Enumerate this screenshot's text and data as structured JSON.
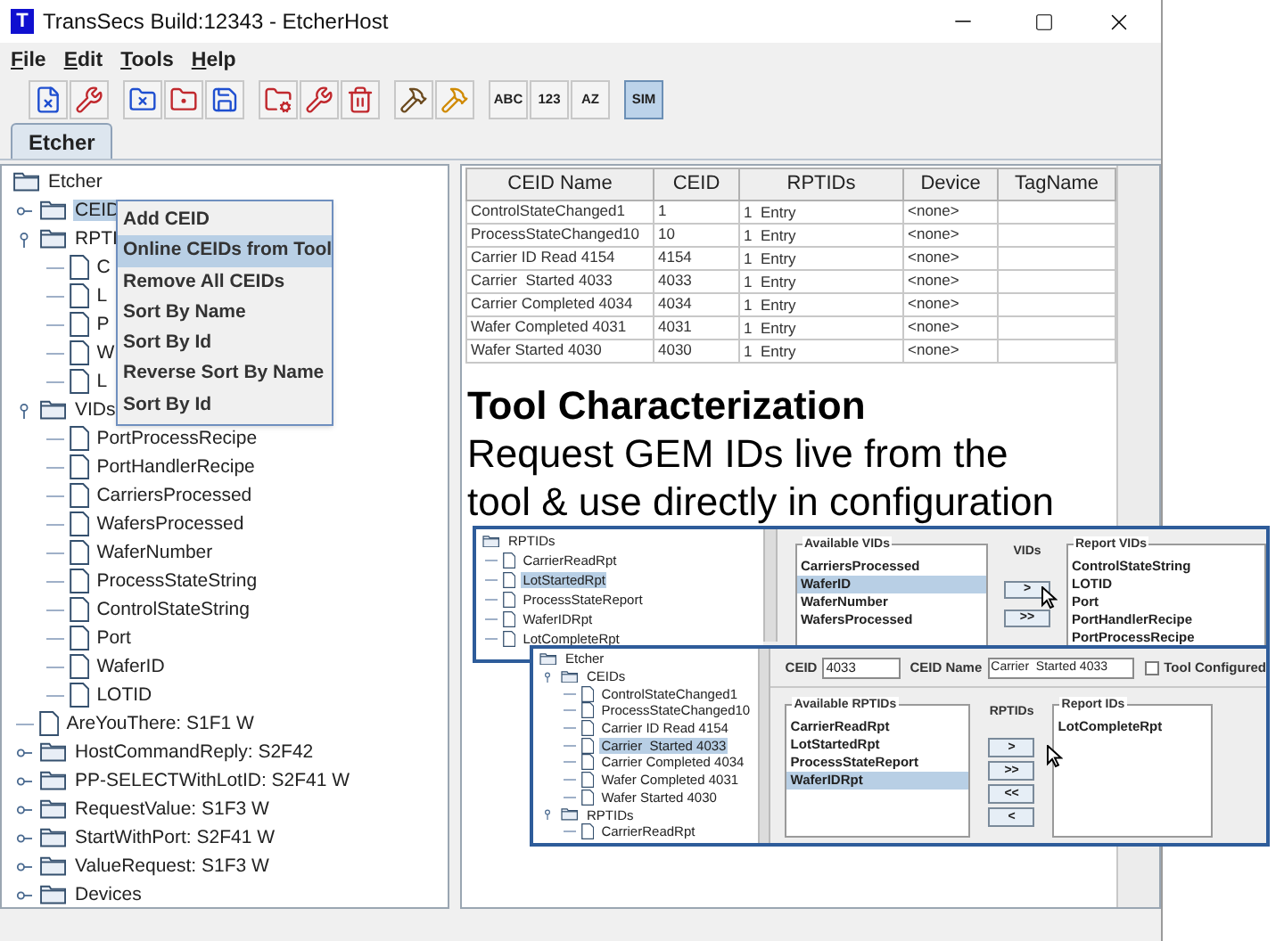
{
  "window": {
    "icon_letter": "T",
    "title": "TransSecs Build:12343 - EtcherHost"
  },
  "menu": [
    {
      "label": "File"
    },
    {
      "label": "Edit"
    },
    {
      "label": "Tools"
    },
    {
      "label": "Help"
    }
  ],
  "toolbar": {
    "groups": [
      [
        {
          "kind": "icon",
          "selected": false
        },
        {
          "kind": "icon",
          "selected": false
        }
      ],
      [
        {
          "kind": "icon",
          "selected": false
        },
        {
          "kind": "icon",
          "selected": false
        },
        {
          "kind": "icon",
          "selected": false
        }
      ],
      [
        {
          "kind": "icon",
          "selected": false
        },
        {
          "kind": "icon",
          "selected": false
        },
        {
          "kind": "icon",
          "selected": false
        }
      ],
      [
        {
          "kind": "icon",
          "selected": false
        },
        {
          "kind": "icon",
          "selected": false
        }
      ],
      [
        {
          "kind": "text",
          "label": "ABC",
          "selected": false
        },
        {
          "kind": "text",
          "label": "123",
          "selected": false
        },
        {
          "kind": "text",
          "label": "AZ",
          "selected": false
        }
      ],
      [
        {
          "kind": "text",
          "label": "SIM",
          "selected": true
        }
      ]
    ]
  },
  "tabs": [
    {
      "label": "Etcher",
      "selected": true
    }
  ],
  "tree": [
    {
      "label": "Etcher",
      "kind": "folder",
      "selected": false,
      "children": [
        {
          "label": "CEID",
          "kind": "folder",
          "expanded": false,
          "selected": true
        },
        {
          "label": "RPTI",
          "kind": "folder",
          "expanded": true,
          "selected": false,
          "children": [
            {
              "label": "C",
              "kind": "leaf",
              "selected": false
            },
            {
              "label": "L",
              "kind": "leaf",
              "selected": false
            },
            {
              "label": "P",
              "kind": "leaf",
              "selected": false
            },
            {
              "label": "W",
              "kind": "leaf",
              "selected": false
            },
            {
              "label": "L",
              "kind": "leaf",
              "selected": false
            }
          ]
        },
        {
          "label": "VIDs",
          "kind": "folder",
          "expanded": true,
          "selected": false,
          "children": [
            {
              "label": "PortProcessRecipe",
              "kind": "leaf",
              "selected": false
            },
            {
              "label": "PortHandlerRecipe",
              "kind": "leaf",
              "selected": false
            },
            {
              "label": "CarriersProcessed",
              "kind": "leaf",
              "selected": false
            },
            {
              "label": "WafersProcessed",
              "kind": "leaf",
              "selected": false
            },
            {
              "label": "WaferNumber",
              "kind": "leaf",
              "selected": false
            },
            {
              "label": "ProcessStateString",
              "kind": "leaf",
              "selected": false
            },
            {
              "label": "ControlStateString",
              "kind": "leaf",
              "selected": false
            },
            {
              "label": "Port",
              "kind": "leaf",
              "selected": false
            },
            {
              "label": "WaferID",
              "kind": "leaf",
              "selected": false
            },
            {
              "label": "LOTID",
              "kind": "leaf",
              "selected": false
            }
          ]
        },
        {
          "label": "AreYouThere: S1F1 W",
          "kind": "leaf",
          "selected": false
        },
        {
          "label": "HostCommandReply: S2F42",
          "kind": "folder",
          "expanded": false,
          "selected": false
        },
        {
          "label": "PP-SELECTWithLotID: S2F41 W",
          "kind": "folder",
          "expanded": false,
          "selected": false
        },
        {
          "label": "RequestValue: S1F3 W",
          "kind": "folder",
          "expanded": false,
          "selected": false
        },
        {
          "label": "StartWithPort: S2F41 W",
          "kind": "folder",
          "expanded": false,
          "selected": false
        },
        {
          "label": "ValueRequest: S1F3 W",
          "kind": "folder",
          "expanded": false,
          "selected": false
        },
        {
          "label": "Devices",
          "kind": "folder",
          "expanded": false,
          "selected": false
        }
      ]
    }
  ],
  "context_menu": {
    "items": [
      {
        "label": "Add CEID",
        "selected": false
      },
      {
        "label": "Online CEIDs from Tool",
        "selected": true
      },
      {
        "label": "Remove All CEIDs",
        "selected": false
      },
      {
        "label": "Sort By Name",
        "selected": false
      },
      {
        "label": "Sort By Id",
        "selected": false
      },
      {
        "label": "Reverse Sort By Name",
        "selected": false
      },
      {
        "label": "Sort By Id",
        "selected": false
      }
    ]
  },
  "table": {
    "columns": [
      "CEID Name",
      "CEID",
      "RPTIDs",
      "Device",
      "TagName"
    ],
    "rows": [
      [
        "ControlStateChanged1",
        "1",
        "1  Entry",
        "<none>",
        ""
      ],
      [
        "ProcessStateChanged10",
        "10",
        "1  Entry",
        "<none>",
        ""
      ],
      [
        "Carrier ID Read 4154",
        "4154",
        "1  Entry",
        "<none>",
        ""
      ],
      [
        "Carrier  Started 4033",
        "4033",
        "1  Entry",
        "<none>",
        ""
      ],
      [
        "Carrier Completed 4034",
        "4034",
        "1  Entry",
        "<none>",
        ""
      ],
      [
        "Wafer Completed 4031",
        "4031",
        "1  Entry",
        "<none>",
        ""
      ],
      [
        "Wafer Started 4030",
        "4030",
        "1  Entry",
        "<none>",
        ""
      ]
    ]
  },
  "headline": {
    "title": "Tool Characterization",
    "lines": [
      "Request GEM IDs live from the",
      "tool & use directly in configuration"
    ]
  },
  "inset_vids": {
    "tree": [
      {
        "label": "RPTIDs",
        "kind": "folder",
        "selected": false,
        "children": [
          {
            "label": "CarrierReadRpt",
            "kind": "leaf",
            "selected": false
          },
          {
            "label": "LotStartedRpt",
            "kind": "leaf",
            "selected": true
          },
          {
            "label": "ProcessStateReport",
            "kind": "leaf",
            "selected": false
          },
          {
            "label": "WaferIDRpt",
            "kind": "leaf",
            "selected": false
          },
          {
            "label": "LotCompleteRpt",
            "kind": "leaf",
            "selected": false
          }
        ]
      }
    ],
    "available": {
      "title": "Available VIDs",
      "items": [
        {
          "label": "CarriersProcessed",
          "selected": false
        },
        {
          "label": "WaferID",
          "selected": true
        },
        {
          "label": "WaferNumber",
          "selected": false
        },
        {
          "label": "WafersProcessed",
          "selected": false
        }
      ]
    },
    "label": "VIDs",
    "buttons": [
      ">",
      ">>"
    ],
    "report": {
      "title": "Report VIDs",
      "items": [
        {
          "label": "ControlStateString",
          "selected": false
        },
        {
          "label": "LOTID",
          "selected": false
        },
        {
          "label": "Port",
          "selected": false
        },
        {
          "label": "PortHandlerRecipe",
          "selected": false
        },
        {
          "label": "PortProcessRecipe",
          "selected": false
        }
      ]
    }
  },
  "inset_ceid": {
    "tree": [
      {
        "label": "Etcher",
        "kind": "folder",
        "selected": false,
        "children": [
          {
            "label": "CEIDs",
            "kind": "folder",
            "expanded": true,
            "selected": false,
            "children": [
              {
                "label": "ControlStateChanged1",
                "kind": "leaf",
                "selected": false
              },
              {
                "label": "ProcessStateChanged10",
                "kind": "leaf",
                "selected": false
              },
              {
                "label": "Carrier ID Read 4154",
                "kind": "leaf",
                "selected": false
              },
              {
                "label": "Carrier  Started 4033",
                "kind": "leaf",
                "selected": true
              },
              {
                "label": "Carrier Completed 4034",
                "kind": "leaf",
                "selected": false
              },
              {
                "label": "Wafer Completed 4031",
                "kind": "leaf",
                "selected": false
              },
              {
                "label": "Wafer Started 4030",
                "kind": "leaf",
                "selected": false
              }
            ]
          },
          {
            "label": "RPTIDs",
            "kind": "folder",
            "expanded": true,
            "selected": false,
            "children": [
              {
                "label": "CarrierReadRpt",
                "kind": "leaf",
                "selected": false
              }
            ]
          }
        ]
      }
    ],
    "ceid": {
      "label": "CEID",
      "value": "4033"
    },
    "ceid_name": {
      "label": "CEID Name",
      "value": "Carrier  Started 4033"
    },
    "tool_configured": {
      "label": "Tool Configured",
      "checked": false
    },
    "available": {
      "title": "Available RPTIDs",
      "items": [
        {
          "label": "CarrierReadRpt",
          "selected": false
        },
        {
          "label": "LotStartedRpt",
          "selected": false
        },
        {
          "label": "ProcessStateReport",
          "selected": false
        },
        {
          "label": "WaferIDRpt",
          "selected": true
        }
      ]
    },
    "label": "RPTIDs",
    "buttons": [
      ">",
      ">>",
      "<<",
      "<"
    ],
    "report": {
      "title": "Report IDs",
      "items": [
        {
          "label": "LotCompleteRpt",
          "selected": false
        }
      ]
    }
  }
}
